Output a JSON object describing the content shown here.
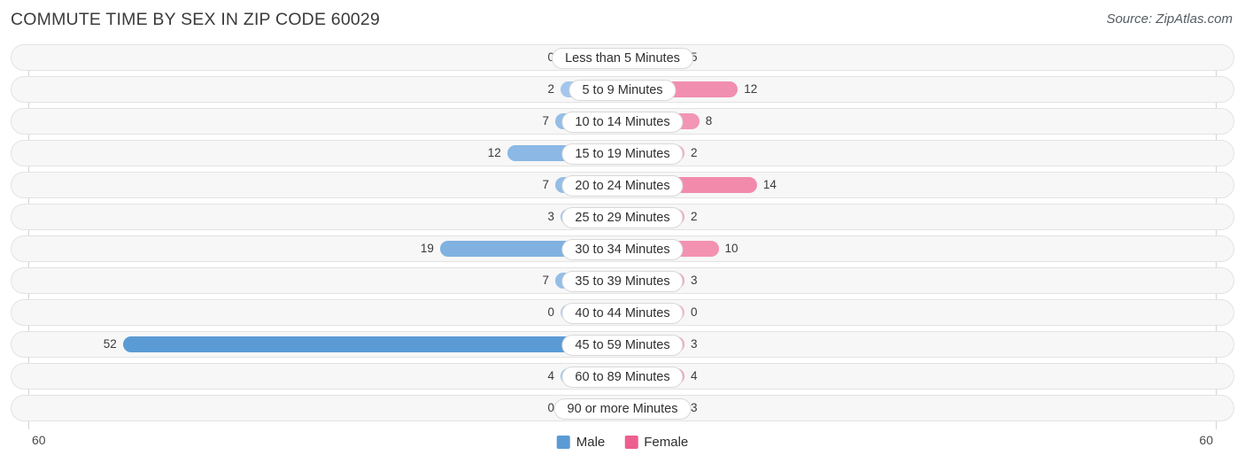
{
  "header": {
    "title": "COMMUTE TIME BY SEX IN ZIP CODE 60029",
    "source": "Source: ZipAtlas.com"
  },
  "axis": {
    "left_tick": "60",
    "right_tick": "60"
  },
  "legend": {
    "items": [
      {
        "label": "Male",
        "color": "#5b9bd5",
        "icon": "square-swatch"
      },
      {
        "label": "Female",
        "color": "#ec5f8e",
        "icon": "square-swatch"
      }
    ]
  },
  "colors": {
    "male_max": "#5b9bd5",
    "male_min": "#b2cff0",
    "female_max": "#ec5f8e",
    "female_min": "#f7b3c9",
    "track": "#f7f7f7",
    "track_border": "#e3e3e3",
    "pill_bg": "#ffffff",
    "axis_line": "#d4d4d4"
  },
  "chart_data": {
    "type": "bar",
    "orientation": "horizontal-diverging",
    "title": "COMMUTE TIME BY SEX IN ZIP CODE 60029",
    "subtitle": "",
    "xlabel": "",
    "ylabel": "",
    "xlim": [
      60,
      60
    ],
    "axis_max": 60,
    "grid": false,
    "legend_position": "bottom-center",
    "categories": [
      "Less than 5 Minutes",
      "5 to 9 Minutes",
      "10 to 14 Minutes",
      "15 to 19 Minutes",
      "20 to 24 Minutes",
      "25 to 29 Minutes",
      "30 to 34 Minutes",
      "35 to 39 Minutes",
      "40 to 44 Minutes",
      "45 to 59 Minutes",
      "60 to 89 Minutes",
      "90 or more Minutes"
    ],
    "series": [
      {
        "name": "Male",
        "color": "#5b9bd5",
        "values": [
          0,
          2,
          7,
          12,
          7,
          3,
          19,
          7,
          0,
          52,
          4,
          0
        ]
      },
      {
        "name": "Female",
        "color": "#ec5f8e",
        "values": [
          5,
          12,
          8,
          2,
          14,
          2,
          10,
          3,
          0,
          3,
          4,
          3
        ]
      }
    ]
  }
}
